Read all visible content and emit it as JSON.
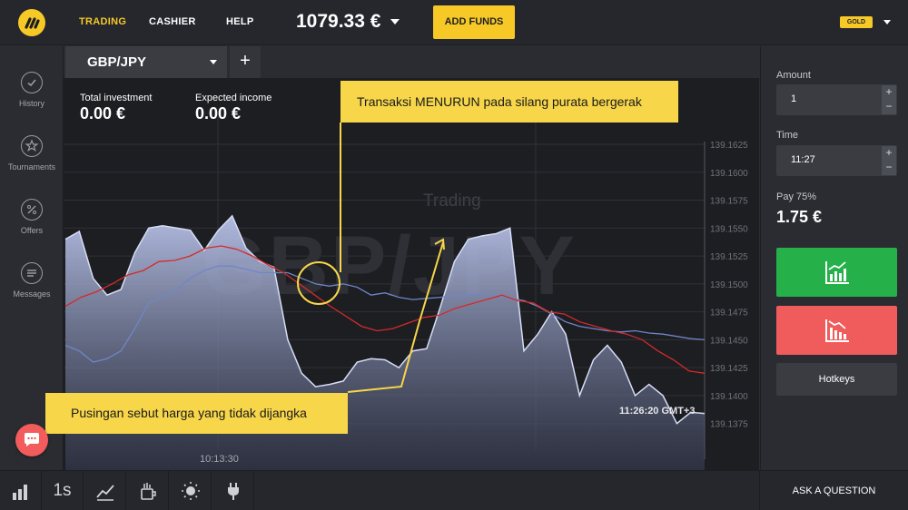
{
  "header": {
    "nav": {
      "trading": "TRADING",
      "cashier": "CASHIER",
      "help": "HELP"
    },
    "balance": "1079.33 €",
    "add_funds": "ADD FUNDS",
    "account_badge": "GOLD"
  },
  "sidebar": {
    "items": [
      {
        "label": "History",
        "icon": "clock-icon"
      },
      {
        "label": "Tournaments",
        "icon": "trophy-icon"
      },
      {
        "label": "Offers",
        "icon": "percent-icon"
      },
      {
        "label": "Messages",
        "icon": "messages-icon"
      }
    ]
  },
  "tabs": {
    "active_asset": "GBP/JPY",
    "add_label": "+"
  },
  "stats": {
    "total_investment_label": "Total investment",
    "total_investment_value": "0.00 €",
    "expected_income_label": "Expected income",
    "expected_income_value": "0.00 €"
  },
  "chart_overlay": {
    "watermark_asset": "GBP/JPY",
    "watermark_mode": "Trading",
    "time_marker": "10:13:30",
    "current_time": "11:26:20 GMT+3"
  },
  "annotations": {
    "top": "Transaksi MENURUN pada silang purata bergerak",
    "bottom": "Pusingan sebut harga yang tidak dijangka"
  },
  "trade_panel": {
    "amount_label": "Amount",
    "amount_value": "1",
    "time_label": "Time",
    "time_value": "11:27",
    "pay_label": "Pay 75%",
    "pay_value": "1.75 €",
    "hotkeys_label": "Hotkeys"
  },
  "bottom_bar": {
    "timeframe": "1s",
    "ask_question": "ASK A QUESTION"
  },
  "colors": {
    "accent": "#f7c927",
    "up": "#26b04a",
    "down": "#f05b5b",
    "callout": "#f7d64a"
  },
  "chart_data": {
    "type": "area",
    "y_ticks": [
      "139.1625",
      "139.1600",
      "139.1575",
      "139.1550",
      "139.1525",
      "139.1500",
      "139.1475",
      "139.1450",
      "139.1425",
      "139.1400",
      "139.1375"
    ],
    "ylim": [
      139.1365,
      139.1625
    ],
    "price_series": [
      139.154,
      139.1547,
      139.1505,
      139.149,
      139.1495,
      139.1528,
      139.155,
      139.1552,
      139.155,
      139.1548,
      139.153,
      139.1548,
      139.1561,
      139.1532,
      139.152,
      139.1515,
      139.145,
      139.142,
      139.1408,
      139.141,
      139.1413,
      139.143,
      139.1433,
      139.1432,
      139.1425,
      139.144,
      139.1442,
      139.148,
      139.152,
      139.154,
      139.1543,
      139.1545,
      139.155,
      139.144,
      139.1455,
      139.1475,
      139.1455,
      139.14,
      139.1432,
      139.1445,
      139.143,
      139.14,
      139.141,
      139.14,
      139.1375,
      139.1385,
      139.1384
    ],
    "moving_average_slow": [
      139.1445,
      139.144,
      139.143,
      139.1433,
      139.144,
      139.146,
      139.1483,
      139.1488,
      139.1495,
      139.1505,
      139.1512,
      139.1516,
      139.1516,
      139.1513,
      139.151,
      139.151,
      139.151,
      139.1505,
      139.15,
      139.1498,
      139.15,
      139.1497,
      139.149,
      139.1492,
      139.1488,
      139.1486,
      139.1487,
      139.1488,
      139.149,
      139.149,
      139.1491,
      139.149,
      139.1487,
      139.1485,
      139.148,
      139.1473,
      139.1466,
      139.1462,
      139.146,
      139.1458,
      139.1457,
      139.1458,
      139.1456,
      139.1455,
      139.1453,
      139.1451,
      139.145
    ],
    "moving_average_fast": [
      139.148,
      139.1488,
      139.1493,
      139.15,
      139.1508,
      139.1512,
      139.152,
      139.1521,
      139.1525,
      139.1532,
      139.1534,
      139.1531,
      139.1525,
      139.1517,
      139.151,
      139.15,
      139.149,
      139.148,
      139.1471,
      139.1462,
      139.1458,
      139.146,
      139.1465,
      139.147,
      139.1472,
      139.1478,
      139.1482,
      139.1486,
      139.149,
      139.1485,
      139.1483,
      139.1475,
      139.1473,
      139.1466,
      139.1462,
      139.1458,
      139.1455,
      139.145,
      139.144,
      139.1432,
      139.1422,
      139.142
    ]
  }
}
